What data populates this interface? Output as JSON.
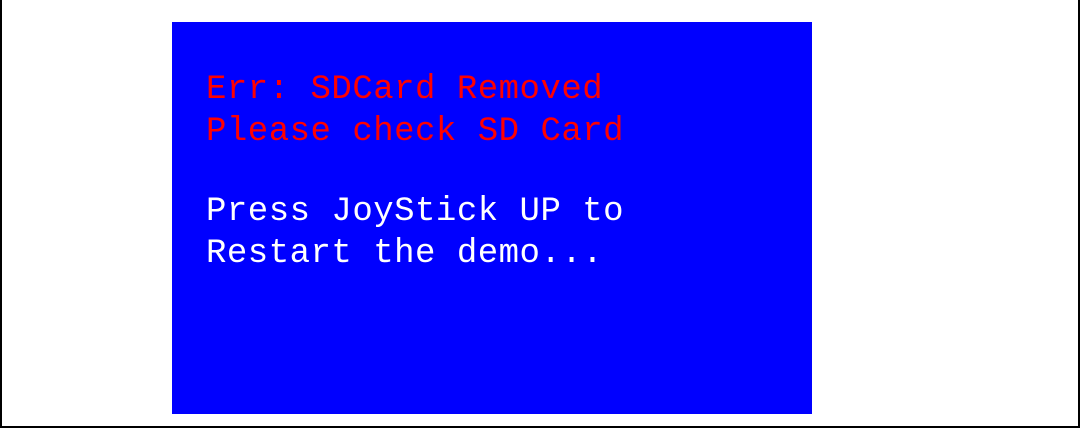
{
  "colors": {
    "screen_background": "#0000FF",
    "error_text": "#FF0000",
    "info_text": "#FFFFFF"
  },
  "lcd": {
    "error": {
      "line1": "Err: SDCard Removed",
      "line2": "Please check SD Card"
    },
    "instruction": {
      "line1": "Press JoyStick UP to",
      "line2": "Restart the demo..."
    }
  }
}
